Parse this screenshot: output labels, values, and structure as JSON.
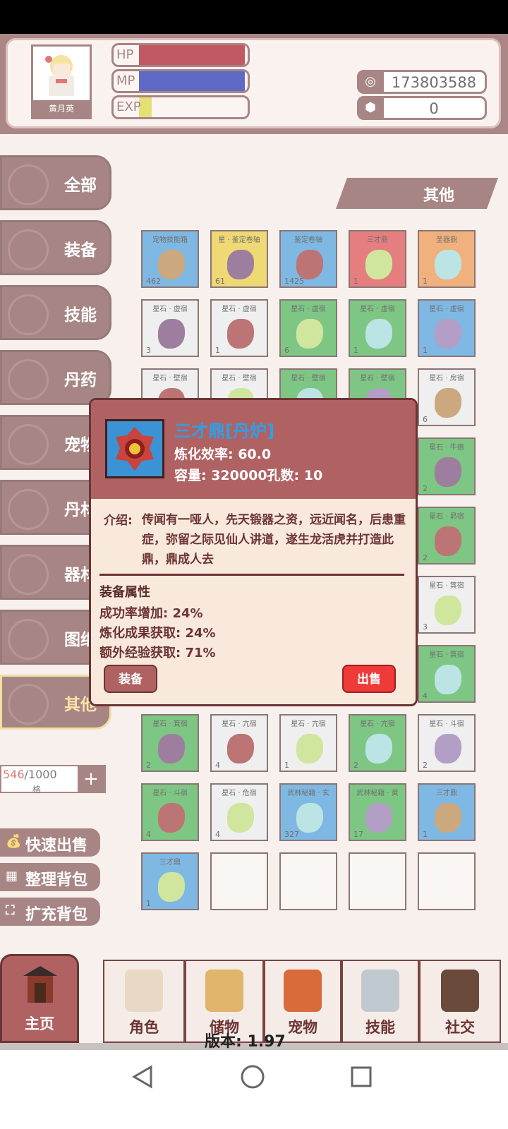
{
  "header": {
    "avatar_name": "黄月英",
    "hp_label": "HP",
    "mp_label": "MP",
    "exp_label": "EXP",
    "hp_fraction": 1.0,
    "mp_fraction": 1.0,
    "exp_fraction": 0.12,
    "currency1": "173803588",
    "currency2": "0"
  },
  "tabs": [
    "全部",
    "装备",
    "技能",
    "丹药",
    "宠物",
    "丹材",
    "器材",
    "图纸",
    "其他"
  ],
  "active_tab": "其他",
  "category_header": "其他",
  "capacity": {
    "used": "546",
    "total": "/1000",
    "unit": "格",
    "plus": "+"
  },
  "side_buttons": {
    "quick_sell": "快速出售",
    "sort": "整理背包",
    "expand": "扩充背包"
  },
  "grid": [
    [
      {
        "n": "宠物技能箱",
        "c": "462",
        "k": "blue"
      },
      {
        "n": "星 · 鉴定卷轴",
        "c": "61",
        "k": "yellow"
      },
      {
        "n": "鉴定卷轴",
        "c": "1425",
        "k": "blue"
      },
      {
        "n": "三才鼎",
        "c": "1",
        "k": "red"
      },
      {
        "n": "圣器鼎",
        "c": "1",
        "k": "orange"
      }
    ],
    [
      {
        "n": "星石 · 虚宿",
        "c": "3",
        "k": "white"
      },
      {
        "n": "星石 · 虚宿",
        "c": "1",
        "k": "white"
      },
      {
        "n": "星石 · 虚宿",
        "c": "6",
        "k": "green"
      },
      {
        "n": "星石 · 虚宿",
        "c": "1",
        "k": "green"
      },
      {
        "n": "星石 · 虚宿",
        "c": "1",
        "k": "blue"
      }
    ],
    [
      {
        "n": "星石 · 壁宿",
        "c": "",
        "k": "white"
      },
      {
        "n": "星石 · 壁宿",
        "c": "",
        "k": "white"
      },
      {
        "n": "星石 · 壁宿",
        "c": "",
        "k": "green"
      },
      {
        "n": "星石 · 壁宿",
        "c": "",
        "k": "green"
      },
      {
        "n": "星石 · 房宿",
        "c": "6",
        "k": "white"
      }
    ],
    [
      {
        "n": "",
        "c": "",
        "k": "white"
      },
      {
        "n": "",
        "c": "",
        "k": "white"
      },
      {
        "n": "",
        "c": "",
        "k": "white"
      },
      {
        "n": "",
        "c": "",
        "k": "white"
      },
      {
        "n": "星石 · 牛宿",
        "c": "2",
        "k": "green"
      }
    ],
    [
      {
        "n": "",
        "c": "",
        "k": "white"
      },
      {
        "n": "",
        "c": "",
        "k": "white"
      },
      {
        "n": "",
        "c": "",
        "k": "white"
      },
      {
        "n": "",
        "c": "",
        "k": "white"
      },
      {
        "n": "星石 · 昴宿",
        "c": "2",
        "k": "green"
      }
    ],
    [
      {
        "n": "",
        "c": "",
        "k": "white"
      },
      {
        "n": "",
        "c": "",
        "k": "white"
      },
      {
        "n": "",
        "c": "",
        "k": "white"
      },
      {
        "n": "",
        "c": "",
        "k": "white"
      },
      {
        "n": "星石 · 箕宿",
        "c": "3",
        "k": "white"
      }
    ],
    [
      {
        "n": "",
        "c": "4",
        "k": "green"
      },
      {
        "n": "",
        "c": "",
        "k": "white"
      },
      {
        "n": "",
        "c": "1",
        "k": "white"
      },
      {
        "n": "",
        "c": "1",
        "k": "green"
      },
      {
        "n": "星石 · 箕宿",
        "c": "4",
        "k": "green"
      }
    ],
    [
      {
        "n": "星石 · 箕宿",
        "c": "2",
        "k": "green"
      },
      {
        "n": "星石 · 亢宿",
        "c": "4",
        "k": "white"
      },
      {
        "n": "星石 · 亢宿",
        "c": "1",
        "k": "white"
      },
      {
        "n": "星石 · 亢宿",
        "c": "2",
        "k": "green"
      },
      {
        "n": "星石 · 斗宿",
        "c": "2",
        "k": "white"
      }
    ],
    [
      {
        "n": "星石 · 斗宿",
        "c": "4",
        "k": "green"
      },
      {
        "n": "星石 · 危宿",
        "c": "4",
        "k": "white"
      },
      {
        "n": "武林秘籍 · 玄",
        "c": "327",
        "k": "blue"
      },
      {
        "n": "武林秘籍 · 黄",
        "c": "17",
        "k": "green"
      },
      {
        "n": "三才鼎",
        "c": "1",
        "k": "blue"
      }
    ],
    [
      {
        "n": "三才鼎",
        "c": "1",
        "k": "blue"
      },
      {
        "n": "",
        "c": "",
        "k": "empty"
      },
      {
        "n": "",
        "c": "",
        "k": "empty"
      },
      {
        "n": "",
        "c": "",
        "k": "empty"
      },
      {
        "n": "",
        "c": "",
        "k": "empty"
      }
    ]
  ],
  "modal": {
    "title": "三才鼎[丹炉]",
    "line1": "炼化效率: 60.0",
    "line2": "容量: 320000孔数: 10",
    "desc_label": "介绍:",
    "desc": "传闻有一哑人，先天锻器之资，远近闻名，后患重症，弥留之际见仙人讲道，遂生龙活虎并打造此鼎，鼎成人去",
    "attr_header": "装备属性",
    "attrs": [
      "成功率增加: 24%",
      "炼化成果获取: 24%",
      "额外经验获取: 71%"
    ],
    "equip_button": "装备",
    "sell_button": "出售"
  },
  "bottom_nav": [
    "主页",
    "角色",
    "储物",
    "宠物",
    "技能",
    "社交"
  ],
  "version": "版本: 1.97",
  "colors": {
    "hp": "#a00010",
    "mp": "#0a1aa8",
    "exp": "#d9d02a",
    "brown": "#7a4444"
  }
}
